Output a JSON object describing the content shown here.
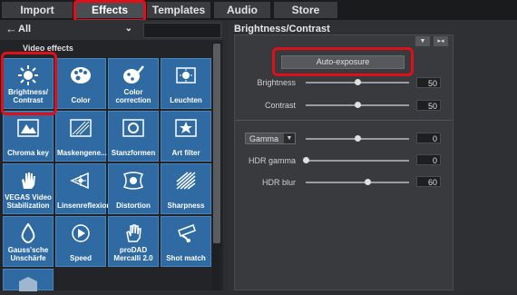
{
  "tabs": [
    {
      "label": "Import"
    },
    {
      "label": "Effects"
    },
    {
      "label": "Templates"
    },
    {
      "label": "Audio"
    },
    {
      "label": "Store"
    }
  ],
  "active_tab": "Effects",
  "left": {
    "category": "All",
    "section_label": "Video effects",
    "tiles": [
      {
        "label": "Brightness/ Contrast",
        "icon": "sun-icon"
      },
      {
        "label": "Color",
        "icon": "palette-icon"
      },
      {
        "label": "Color correction",
        "icon": "brush-palette-icon"
      },
      {
        "label": "Leuchten",
        "icon": "glow-icon"
      },
      {
        "label": "Chroma key",
        "icon": "chroma-key-icon"
      },
      {
        "label": "Maskengene...",
        "icon": "mask-icon"
      },
      {
        "label": "Stanzformen",
        "icon": "stamp-shape-icon"
      },
      {
        "label": "Art filter",
        "icon": "star-filter-icon"
      },
      {
        "label": "VEGAS Video Stabilization",
        "icon": "hand-stabilize-icon"
      },
      {
        "label": "Linsenreflexion",
        "icon": "lens-flare-icon"
      },
      {
        "label": "Distortion",
        "icon": "distortion-icon"
      },
      {
        "label": "Sharpness",
        "icon": "sharpness-icon"
      },
      {
        "label": "Gauss'sche Unschärfe",
        "icon": "blur-drop-icon"
      },
      {
        "label": "Speed",
        "icon": "speed-icon"
      },
      {
        "label": "proDAD Mercalli 2.0",
        "icon": "mercalli-hand-icon"
      },
      {
        "label": "Shot match",
        "icon": "shot-match-icon"
      }
    ]
  },
  "right": {
    "title": "Brightness/Contrast",
    "auto_exposure_label": "Auto-exposure",
    "brightness": {
      "label": "Brightness",
      "value": "50",
      "level": 0.5
    },
    "contrast": {
      "label": "Contrast",
      "value": "50",
      "level": 0.5
    },
    "gamma": {
      "label": "Gamma",
      "value": "0",
      "level": 0.5
    },
    "hdr_gamma": {
      "label": "HDR gamma",
      "value": "0",
      "level": 0.0
    },
    "hdr_blur": {
      "label": "HDR blur",
      "value": "60",
      "level": 0.6
    }
  },
  "colors": {
    "highlight": "#e0101a",
    "tile": "#2f6aa3"
  }
}
